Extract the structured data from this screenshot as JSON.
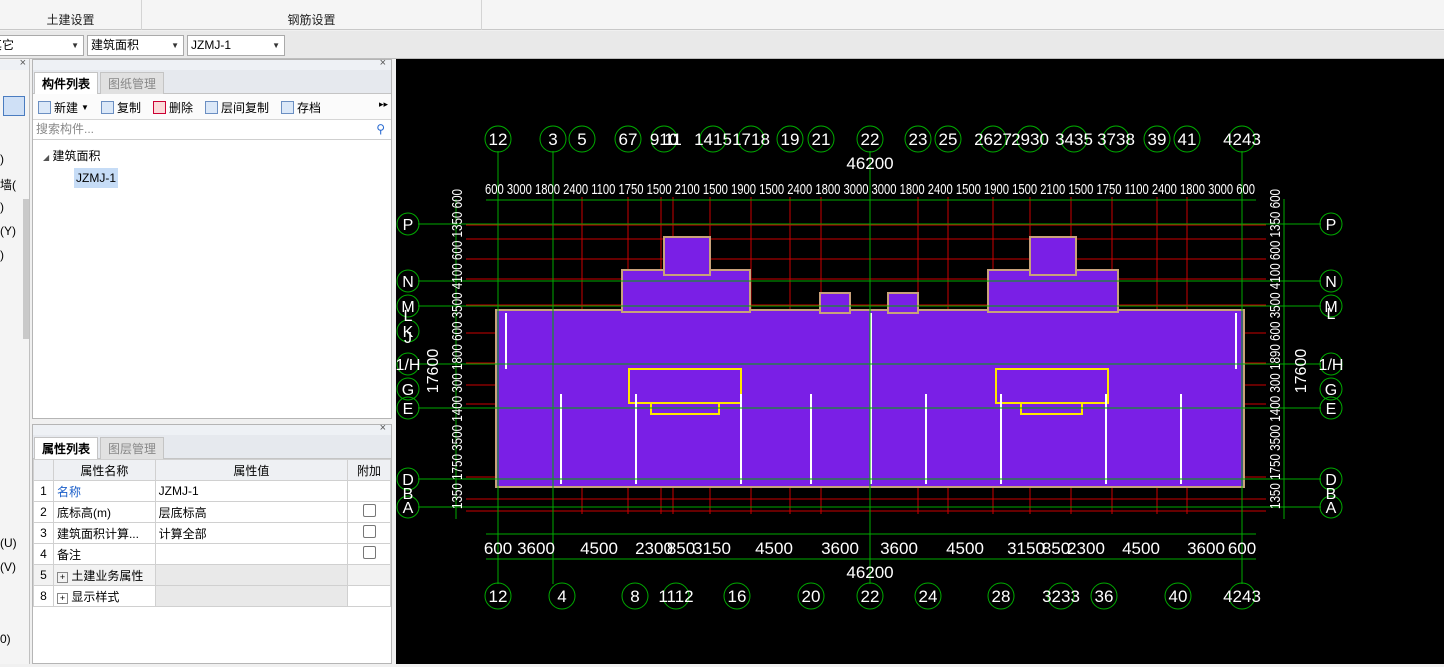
{
  "ribbon": {
    "civil_label": "土建设置",
    "rebar_label": "钢筋设置"
  },
  "selectors": {
    "floor": "其它",
    "type": "建筑面积",
    "component": "JZMJ-1"
  },
  "left_strip": [
    ")",
    "墙(",
    ")",
    "(Y)",
    ")",
    "(U)",
    "(V)",
    "0)"
  ],
  "component_pane": {
    "tabs": [
      "构件列表",
      "图纸管理"
    ],
    "toolbar": {
      "new": "新建",
      "copy": "复制",
      "delete": "删除",
      "floor_copy": "层间复制",
      "archive": "存档"
    },
    "search_placeholder": "搜索构件...",
    "tree_root": "建筑面积",
    "tree_child": "JZMJ-1"
  },
  "property_pane": {
    "tabs": [
      "属性列表",
      "图层管理"
    ],
    "headers": {
      "name": "属性名称",
      "value": "属性值",
      "extra": "附加"
    },
    "rows": [
      {
        "idx": "1",
        "name": "名称",
        "value": "JZMJ-1",
        "check": false
      },
      {
        "idx": "2",
        "name": "底标高(m)",
        "value": "层底标高",
        "check": true
      },
      {
        "idx": "3",
        "name": "建筑面积计算...",
        "value": "计算全部",
        "check": true
      },
      {
        "idx": "4",
        "name": "备注",
        "value": "",
        "check": true
      },
      {
        "idx": "5",
        "name": "土建业务属性",
        "value": "",
        "check": false
      },
      {
        "idx": "8",
        "name": "显示样式",
        "value": "",
        "check": false
      }
    ]
  },
  "drawing": {
    "top_total": "46200",
    "bottom_total": "46200",
    "top_axes": [
      "12",
      "3",
      "5",
      "67",
      "910",
      "11",
      "1415",
      "1718",
      "19",
      "21",
      "22",
      "23",
      "25",
      "2627",
      "2930",
      "3435",
      "3738",
      "39",
      "41",
      "4243"
    ],
    "bottom_axes": [
      "12",
      "4",
      "8",
      "1112",
      "16",
      "20",
      "22",
      "24",
      "28",
      "3233",
      "36",
      "40",
      "4243"
    ],
    "top_dims": "600 3000 1800 2400 1100 1750 1500 2100 1500 1900 1500 2400 1800 3000 3000 1800 2400 1500 1900 1500 2100 1500 1750 1100 2400 1800 3000 600",
    "bottom_dims": [
      "600",
      "3600",
      "4500",
      "2300",
      "850",
      "3150",
      "4500",
      "3600",
      "3600",
      "4500",
      "3150",
      "850",
      "2300",
      "4500",
      "3600",
      "600"
    ],
    "left_axes": [
      "P",
      "N",
      "M",
      "L",
      "K",
      "J",
      "1/H",
      "G",
      "E",
      "D",
      "B",
      "A"
    ],
    "right_axes": [
      "P",
      "N",
      "M",
      "L",
      "1/H",
      "G",
      "E",
      "D",
      "B",
      "A"
    ],
    "left_vertical_total": "17600",
    "right_vertical_total": "17600",
    "left_vertical_dims": "1350 1750 3500 1400 300 1800 600 3500 4100 600 1350 600",
    "right_vertical_dims": "1350 1750 3500 1400 300 1890 600 3500 4100 600 1350 600",
    "colors": {
      "fill": "#7a1fe6",
      "grid": "#cc0000",
      "axis": "#00aa00",
      "dim": "#ffffff",
      "wall": "#c8a27a",
      "accent": "#ffe600"
    }
  }
}
